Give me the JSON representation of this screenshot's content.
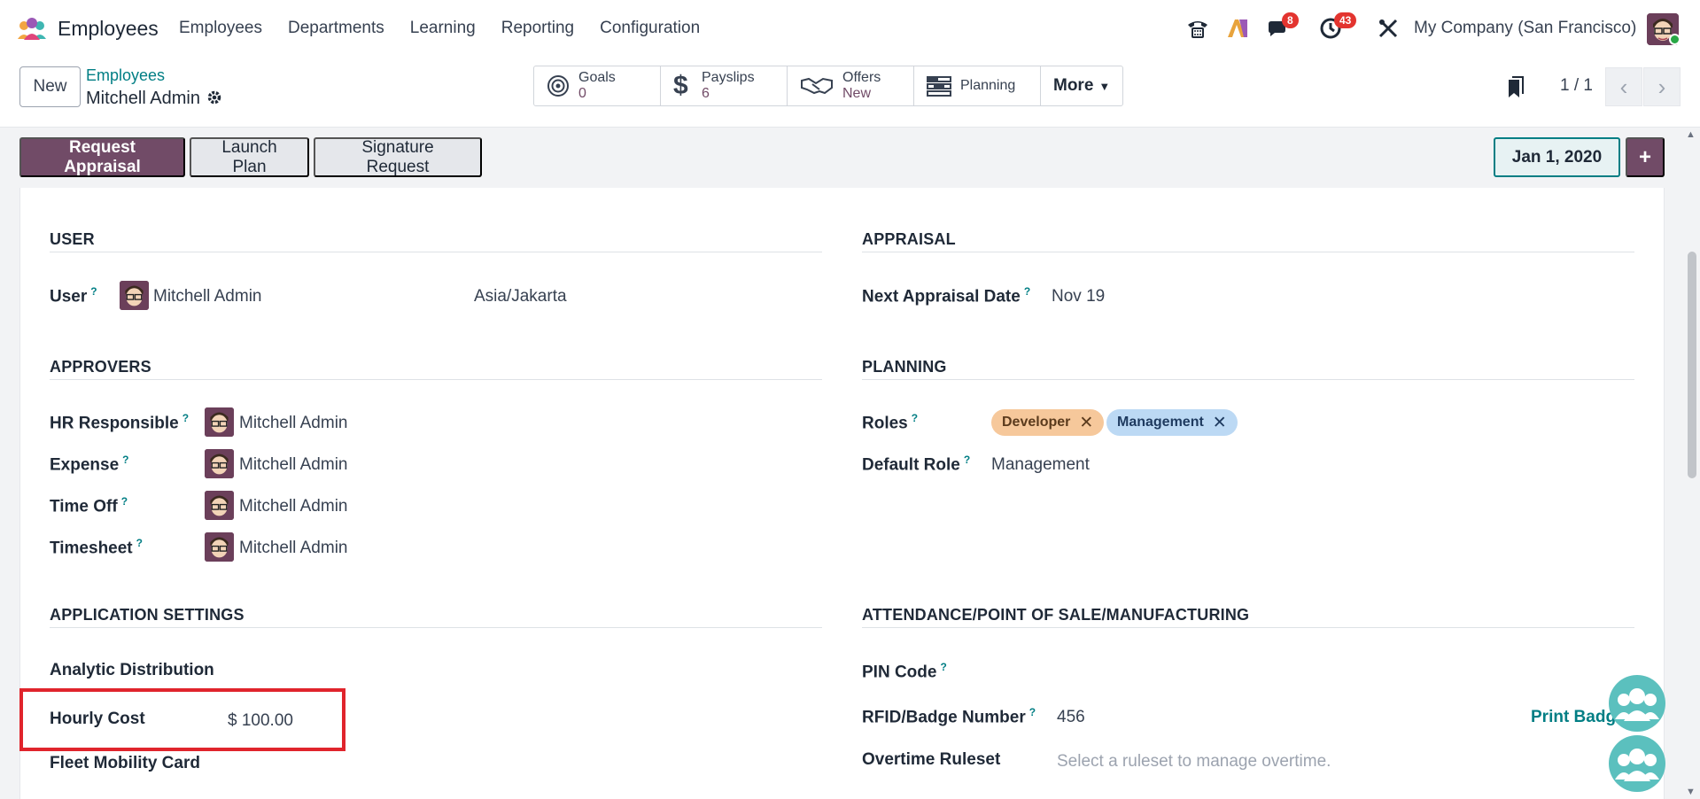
{
  "navbar": {
    "app_name": "Employees",
    "menu": [
      "Employees",
      "Departments",
      "Learning",
      "Reporting",
      "Configuration"
    ],
    "messages_badge": "8",
    "activities_badge": "43",
    "company": "My Company (San Francisco)"
  },
  "control": {
    "new_label": "New",
    "breadcrumb_parent": "Employees",
    "breadcrumb_current": "Mitchell Admin",
    "smart_buttons": [
      {
        "title": "Goals",
        "value": "0"
      },
      {
        "title": "Payslips",
        "value": "6"
      },
      {
        "title": "Offers",
        "value": "New"
      },
      {
        "title": "Planning",
        "value": ""
      }
    ],
    "more_label": "More",
    "pager": "1 / 1"
  },
  "actions": {
    "request_appraisal": "Request Appraisal",
    "launch_plan": "Launch Plan",
    "signature_request": "Signature Request",
    "date": "Jan 1, 2020"
  },
  "user_section": {
    "title": "USER",
    "user_label": "User",
    "user_value": "Mitchell Admin",
    "timezone": "Asia/Jakarta"
  },
  "appraisal_section": {
    "title": "APPRAISAL",
    "next_label": "Next Appraisal Date",
    "next_value": "Nov 19"
  },
  "approvers_section": {
    "title": "APPROVERS",
    "rows": [
      {
        "label": "HR Responsible",
        "value": "Mitchell Admin"
      },
      {
        "label": "Expense",
        "value": "Mitchell Admin"
      },
      {
        "label": "Time Off",
        "value": "Mitchell Admin"
      },
      {
        "label": "Timesheet",
        "value": "Mitchell Admin"
      }
    ]
  },
  "planning_section": {
    "title": "PLANNING",
    "roles_label": "Roles",
    "roles": [
      "Developer",
      "Management"
    ],
    "default_role_label": "Default Role",
    "default_role_value": "Management"
  },
  "app_settings": {
    "title": "APPLICATION SETTINGS",
    "analytic_label": "Analytic Distribution",
    "hourly_label": "Hourly Cost",
    "hourly_value": "$ 100.00",
    "fleet_label": "Fleet Mobility Card"
  },
  "attendance": {
    "title": "ATTENDANCE/POINT OF SALE/MANUFACTURING",
    "pin_label": "PIN Code",
    "rfid_label": "RFID/Badge Number",
    "rfid_value": "456",
    "print_badge": "Print Badge",
    "overtime_label": "Overtime Ruleset",
    "overtime_placeholder": "Select a ruleset to manage overtime."
  },
  "colors": {
    "primary": "#714b67",
    "link": "#017e84",
    "highlight": "#e0242c"
  }
}
